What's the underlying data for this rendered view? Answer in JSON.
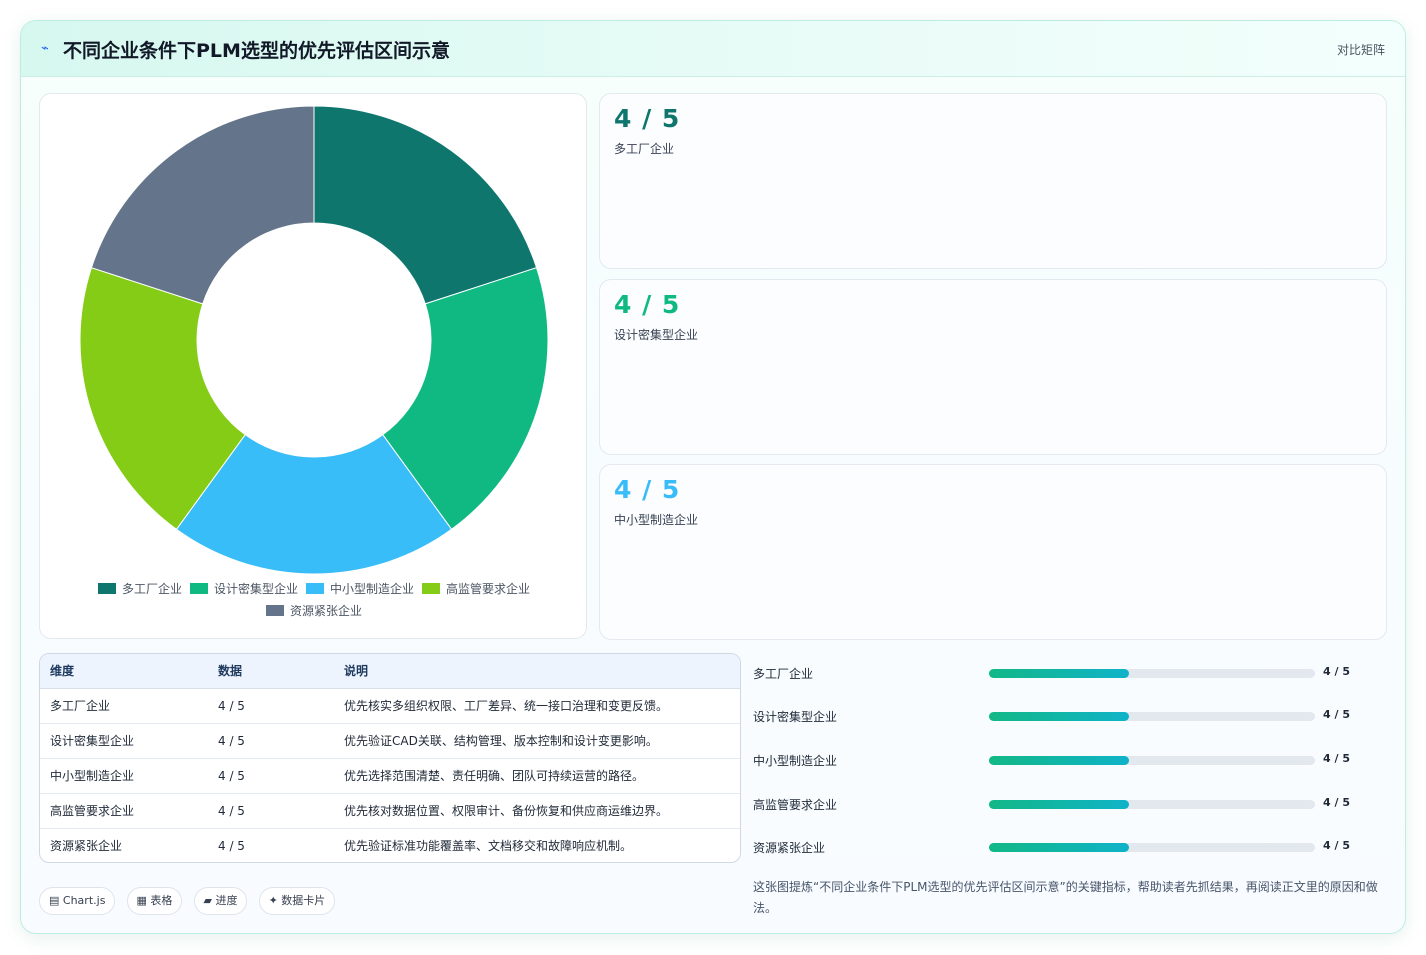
{
  "header": {
    "icon": "bolt-icon",
    "title": "不同企业条件下PLM选型的优先评估区间示意",
    "tag": "对比矩阵"
  },
  "colors": {
    "s1": "#0f766e",
    "s2": "#10b981",
    "s3": "#38bdf8",
    "s4": "#84cc16",
    "s5": "#64748b"
  },
  "chart_data": {
    "type": "doughnut",
    "categories": [
      "多工厂企业",
      "设计密集型企业",
      "中小型制造企业",
      "高监管要求企业",
      "资源紧张企业"
    ],
    "values": [
      4,
      4,
      4,
      4,
      4
    ],
    "legend_position": "bottom"
  },
  "stats": [
    {
      "value": "4 / 5",
      "label": "多工厂企业"
    },
    {
      "value": "4 / 5",
      "label": "设计密集型企业"
    },
    {
      "value": "4 / 5",
      "label": "中小型制造企业"
    }
  ],
  "table": {
    "headers": [
      "维度",
      "数据",
      "说明"
    ],
    "rows": [
      [
        "多工厂企业",
        "4 / 5",
        "优先核实多组织权限、工厂差异、统一接口治理和变更反馈。"
      ],
      [
        "设计密集型企业",
        "4 / 5",
        "优先验证CAD关联、结构管理、版本控制和设计变更影响。"
      ],
      [
        "中小型制造企业",
        "4 / 5",
        "优先选择范围清楚、责任明确、团队可持续运营的路径。"
      ],
      [
        "高监管要求企业",
        "4 / 5",
        "优先核对数据位置、权限审计、备份恢复和供应商运维边界。"
      ],
      [
        "资源紧张企业",
        "4 / 5",
        "优先验证标准功能覆盖率、文档移交和故障响应机制。"
      ]
    ]
  },
  "progress": [
    {
      "label": "多工厂企业",
      "value": "4 / 5",
      "fraction": 0.43
    },
    {
      "label": "设计密集型企业",
      "value": "4 / 5",
      "fraction": 0.43
    },
    {
      "label": "中小型制造企业",
      "value": "4 / 5",
      "fraction": 0.43
    },
    {
      "label": "高监管要求企业",
      "value": "4 / 5",
      "fraction": 0.43
    },
    {
      "label": "资源紧张企业",
      "value": "4 / 5",
      "fraction": 0.43
    }
  ],
  "note": "这张图提炼“不同企业条件下PLM选型的优先评估区间示意”的关键指标，帮助读者先抓结果，再阅读正文里的原因和做法。",
  "pills": [
    {
      "icon": "chart-icon",
      "glyph": "▤",
      "label": "Chart.js"
    },
    {
      "icon": "table-icon",
      "glyph": "▦",
      "label": "表格"
    },
    {
      "icon": "progress-icon",
      "glyph": "▰",
      "label": "进度"
    },
    {
      "icon": "card-icon",
      "glyph": "✦",
      "label": "数据卡片"
    }
  ]
}
